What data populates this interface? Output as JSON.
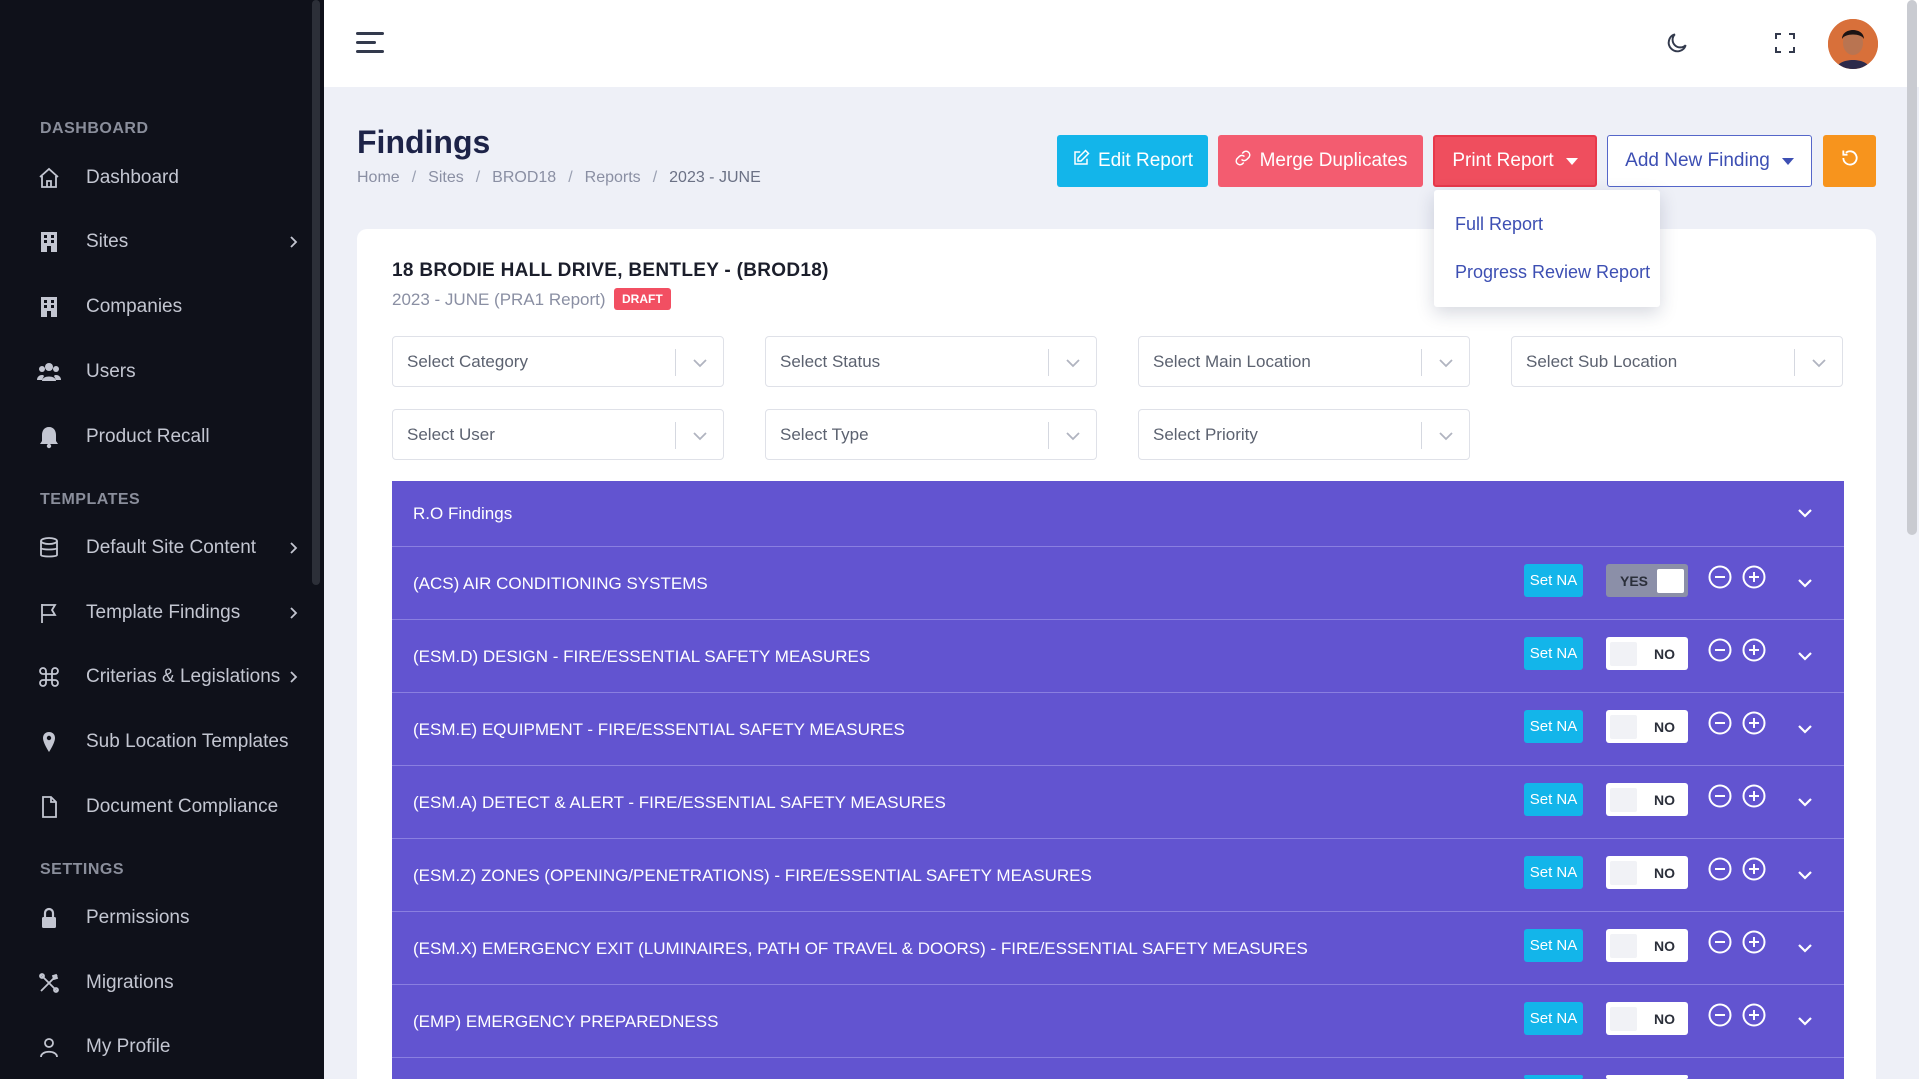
{
  "sidebar": {
    "sections": [
      "DASHBOARD",
      "TEMPLATES",
      "SETTINGS"
    ],
    "items": [
      {
        "label": "Dashboard",
        "icon": "home-icon",
        "has_children": false
      },
      {
        "label": "Sites",
        "icon": "building-icon",
        "has_children": true
      },
      {
        "label": "Companies",
        "icon": "building-icon",
        "has_children": false
      },
      {
        "label": "Users",
        "icon": "users-icon",
        "has_children": false
      },
      {
        "label": "Product Recall",
        "icon": "bell-icon",
        "has_children": false
      },
      {
        "label": "Default Site Content",
        "icon": "database-icon",
        "has_children": true
      },
      {
        "label": "Template Findings",
        "icon": "flag-icon",
        "has_children": true
      },
      {
        "label": "Criterias & Legislations",
        "icon": "command-icon",
        "has_children": true
      },
      {
        "label": "Sub Location Templates",
        "icon": "map-pin-icon",
        "has_children": false
      },
      {
        "label": "Document Compliance",
        "icon": "file-icon",
        "has_children": false
      },
      {
        "label": "Permissions",
        "icon": "lock-icon",
        "has_children": false
      },
      {
        "label": "Migrations",
        "icon": "tools-icon",
        "has_children": false
      },
      {
        "label": "My Profile",
        "icon": "user-icon",
        "has_children": false
      }
    ]
  },
  "header": {
    "title": "Findings",
    "breadcrumb": [
      "Home",
      "Sites",
      "BROD18",
      "Reports",
      "2023 - JUNE"
    ],
    "buttons": {
      "edit": "Edit Report",
      "merge": "Merge Duplicates",
      "print": "Print Report",
      "add": "Add New Finding"
    },
    "print_menu": [
      "Full Report",
      "Progress Review Report"
    ]
  },
  "card": {
    "site_title": "18 BRODIE HALL DRIVE, BENTLEY - (BROD18)",
    "report_sub": "2023 - JUNE (PRA1 Report)",
    "badge": "DRAFT",
    "filters": [
      "Select Category",
      "Select Status",
      "Select Main Location",
      "Select Sub Location",
      "Select User",
      "Select Type",
      "Select Priority"
    ]
  },
  "findings": {
    "header": "R.O Findings",
    "set_na_label": "Set NA",
    "rows": [
      {
        "label": "(ACS) AIR CONDITIONING SYSTEMS",
        "toggle": "YES"
      },
      {
        "label": "(ESM.D) DESIGN - FIRE/ESSENTIAL SAFETY MEASURES",
        "toggle": "NO"
      },
      {
        "label": "(ESM.E) EQUIPMENT - FIRE/ESSENTIAL SAFETY MEASURES",
        "toggle": "NO"
      },
      {
        "label": "(ESM.A) DETECT & ALERT - FIRE/ESSENTIAL SAFETY MEASURES",
        "toggle": "NO"
      },
      {
        "label": "(ESM.Z) ZONES (OPENING/PENETRATIONS) - FIRE/ESSENTIAL SAFETY MEASURES",
        "toggle": "NO"
      },
      {
        "label": "(ESM.X) EMERGENCY EXIT (LUMINAIRES, PATH OF TRAVEL & DOORS) - FIRE/ESSENTIAL SAFETY MEASURES",
        "toggle": "NO"
      },
      {
        "label": "(EMP) EMERGENCY PREPAREDNESS",
        "toggle": "NO"
      }
    ]
  },
  "colors": {
    "sidebar_bg": "#0f111a",
    "accordion_bg": "#6254d0",
    "accent_cyan": "#13b5ea",
    "accent_red": "#ef4e5e",
    "accent_orange": "#f7941d",
    "accent_indigo": "#3d4fb3"
  }
}
